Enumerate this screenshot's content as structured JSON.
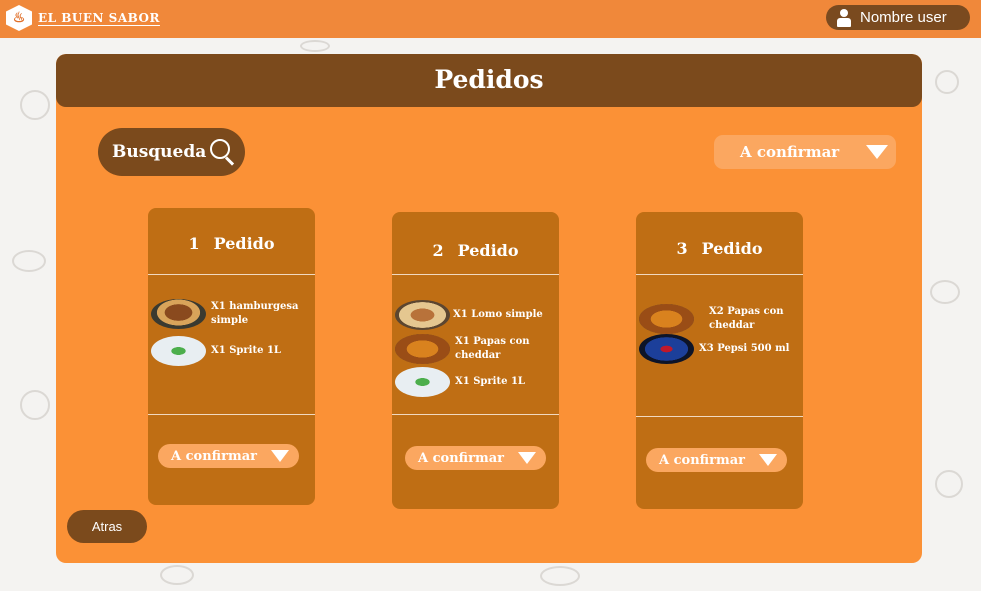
{
  "brand": {
    "logo_glyph": "♨",
    "name": "EL BUEN SABOR"
  },
  "user": {
    "name": "Nombre user"
  },
  "page": {
    "title": "Pedidos"
  },
  "search": {
    "label": "Busqueda"
  },
  "filter": {
    "selected": "A confirmar"
  },
  "orders": [
    {
      "number": "1",
      "label": "Pedido",
      "items": [
        {
          "text": "X1 hamburgesa simple",
          "image": "hamburger"
        },
        {
          "text": "X1 Sprite 1L",
          "image": "sprite-bottle"
        }
      ],
      "status": "A confirmar"
    },
    {
      "number": "2",
      "label": "Pedido",
      "items": [
        {
          "text": "X1 Lomo simple",
          "image": "lomo-sandwich"
        },
        {
          "text": "X1 Papas con cheddar",
          "image": "fries-cheddar"
        },
        {
          "text": "X1 Sprite 1L",
          "image": "sprite-bottle"
        }
      ],
      "status": "A confirmar"
    },
    {
      "number": "3",
      "label": "Pedido",
      "items": [
        {
          "text": "X2 Papas con cheddar",
          "image": "fries-cheddar"
        },
        {
          "text": "X3 Pepsi 500 ml",
          "image": "pepsi-can"
        }
      ],
      "status": "A confirmar"
    }
  ],
  "back": {
    "label": "Atras"
  },
  "colors": {
    "topbar": "#f0883a",
    "panel": "#fb9136",
    "header": "#7b4a1c",
    "card": "#bf6e14",
    "pill": "#fba760"
  }
}
